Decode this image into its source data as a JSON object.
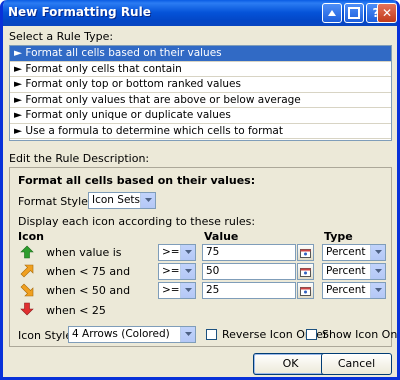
{
  "window": {
    "title": "New Formatting Rule"
  },
  "rule_type": {
    "label": "Select a Rule Type:",
    "items": [
      "► Format all cells based on their values",
      "► Format only cells that contain",
      "► Format only top or bottom ranked values",
      "► Format only values that are above or below average",
      "► Format only unique or duplicate values",
      "► Use a formula to determine which cells to format"
    ],
    "selected_index": 0
  },
  "description": {
    "label": "Edit the Rule Description:",
    "heading": "Format all cells based on their values:",
    "format_style_label": "Format Style:",
    "format_style_value": "Icon Sets",
    "display_note": "Display each icon according to these rules:",
    "col_icon": "Icon",
    "col_value": "Value",
    "col_type": "Type",
    "rows": [
      {
        "icon": "arrow-up-green-icon",
        "text": "when value is",
        "op": ">=",
        "value": "75",
        "type": "Percent"
      },
      {
        "icon": "arrow-up-right-orange-icon",
        "text": "when < 75 and",
        "op": ">=",
        "value": "50",
        "type": "Percent"
      },
      {
        "icon": "arrow-down-right-orange-icon",
        "text": "when < 50 and",
        "op": ">=",
        "value": "25",
        "type": "Percent"
      },
      {
        "icon": "arrow-down-red-icon",
        "text": "when < 25"
      }
    ],
    "icon_style_label": "Icon Style:",
    "icon_style_value": "4 Arrows (Colored)",
    "reverse_label": "Reverse Icon Order",
    "show_only_label": "Show Icon Only"
  },
  "buttons": {
    "ok": "OK",
    "cancel": "Cancel"
  },
  "colors": {
    "titlebar": "#0553d8",
    "selection": "#316ac5",
    "arrow_green": "#2e9e2e",
    "arrow_orange": "#f0a020",
    "arrow_red": "#e03030"
  }
}
